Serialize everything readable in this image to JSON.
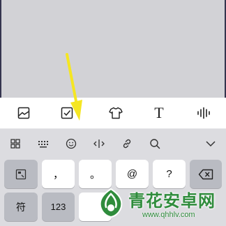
{
  "colors": {
    "page_bg": "#d2d2d6",
    "accent": "#f5e623",
    "watermark": "#2f8c3c",
    "frame": "#34344e"
  },
  "editor_toolbar": {
    "icons": [
      "image-icon",
      "checkbox-icon",
      "tshirt-icon",
      "text-style-icon",
      "audio-wave-icon"
    ],
    "text_icon_glyph": "T"
  },
  "keyboard_toolbar": {
    "icons": [
      "grid-icon",
      "keyboard-icon",
      "emoji-icon",
      "cursor-icon",
      "link-icon",
      "search-icon",
      "chevron-down-icon"
    ]
  },
  "keyboard": {
    "row1": [
      "，",
      "。",
      "@",
      "?"
    ],
    "symbols_key": "符",
    "numbers_key": "123"
  },
  "watermark": {
    "title": "青花安卓网",
    "url": "www.qhhlv.com"
  }
}
